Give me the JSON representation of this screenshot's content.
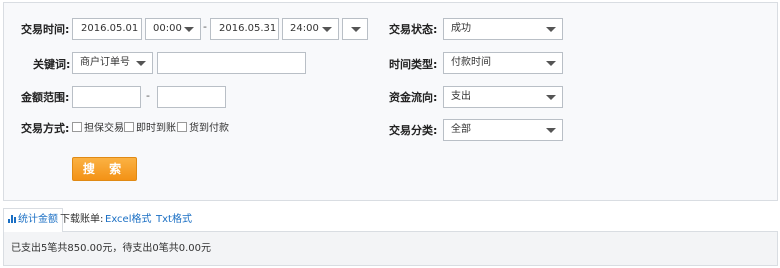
{
  "filters": {
    "trade_time": {
      "label": "交易时间:",
      "start_date": "2016.05.01",
      "start_time": "00:00",
      "separator": "-",
      "end_date": "2016.05.31",
      "end_time": "24:00"
    },
    "keyword": {
      "label": "关键词:",
      "type": "商户订单号",
      "value": ""
    },
    "amount": {
      "label": "金额范围:",
      "min": "",
      "separator": "-",
      "max": ""
    },
    "method": {
      "label": "交易方式:",
      "options": [
        "担保交易",
        "即时到账",
        "货到付款"
      ]
    },
    "status": {
      "label": "交易状态:",
      "value": "成功"
    },
    "time_type": {
      "label": "时间类型:",
      "value": "付款时间"
    },
    "flow": {
      "label": "资金流向:",
      "value": "支出"
    },
    "category": {
      "label": "交易分类:",
      "value": "全部"
    },
    "search_button": "搜 索"
  },
  "tabs": {
    "stats_label": "统计金额",
    "download_label": "下载账单:",
    "excel_label": "Excel格式",
    "txt_label": "Txt格式"
  },
  "summary": "已支出5笔共850.00元，待支出0笔共0.00元",
  "colors": {
    "accent": "#f39216",
    "link": "#1a6fc4"
  },
  "icons": [
    "chevron-down-icon",
    "bar-chart-icon",
    "checkbox-icon"
  ]
}
